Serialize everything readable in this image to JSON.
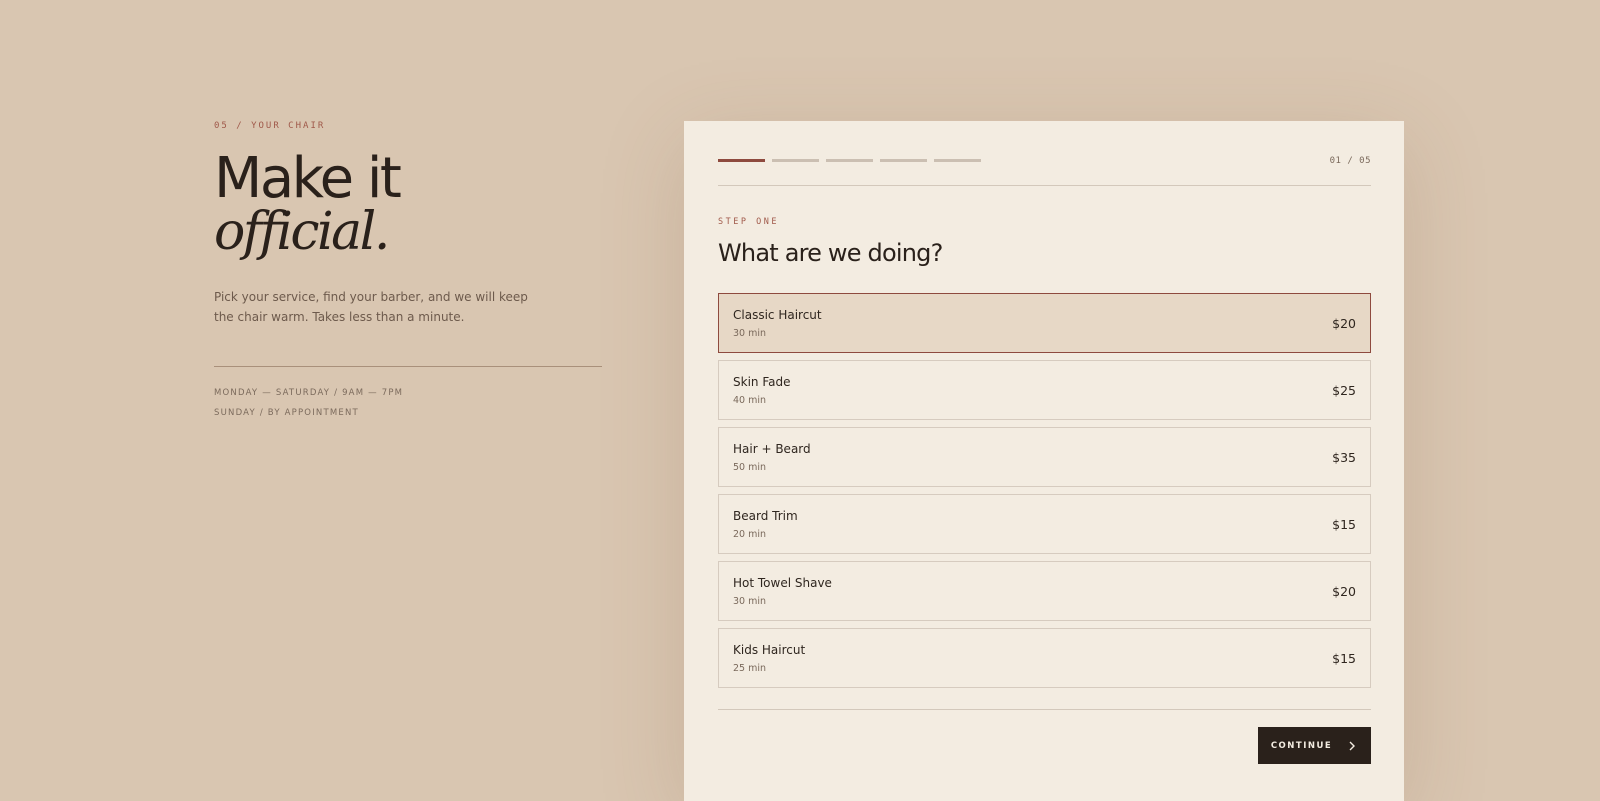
{
  "intro": {
    "eyebrow": "05 / YOUR CHAIR",
    "headline": "Make it",
    "headline_italic": "official.",
    "lede": "Pick your service, find your barber, and we will keep the chair warm. Takes less than a minute.",
    "hours": [
      "MONDAY — SATURDAY / 9AM — 7PM",
      "SUNDAY / BY APPOINTMENT"
    ]
  },
  "booking": {
    "progress": {
      "current_step": 1,
      "total_steps": 5
    },
    "counter": "01 / 05",
    "step_label": "STEP ONE",
    "step_title": "What are we doing?",
    "services": [
      {
        "name": "Classic Haircut",
        "duration": "30 min",
        "price": "$20",
        "selected": true
      },
      {
        "name": "Skin Fade",
        "duration": "40 min",
        "price": "$25",
        "selected": false
      },
      {
        "name": "Hair + Beard",
        "duration": "50 min",
        "price": "$35",
        "selected": false
      },
      {
        "name": "Beard Trim",
        "duration": "20 min",
        "price": "$15",
        "selected": false
      },
      {
        "name": "Hot Towel Shave",
        "duration": "30 min",
        "price": "$20",
        "selected": false
      },
      {
        "name": "Kids Haircut",
        "duration": "25 min",
        "price": "$15",
        "selected": false
      }
    ],
    "continue_label": "CONTINUE",
    "continue_icon": "chevron-right-icon"
  },
  "colors": {
    "background": "#d9c6b1",
    "card": "#f3ece1",
    "accent": "#8e4a3e",
    "ink": "#2a211b",
    "selected_fill": "#e7d8c6"
  }
}
